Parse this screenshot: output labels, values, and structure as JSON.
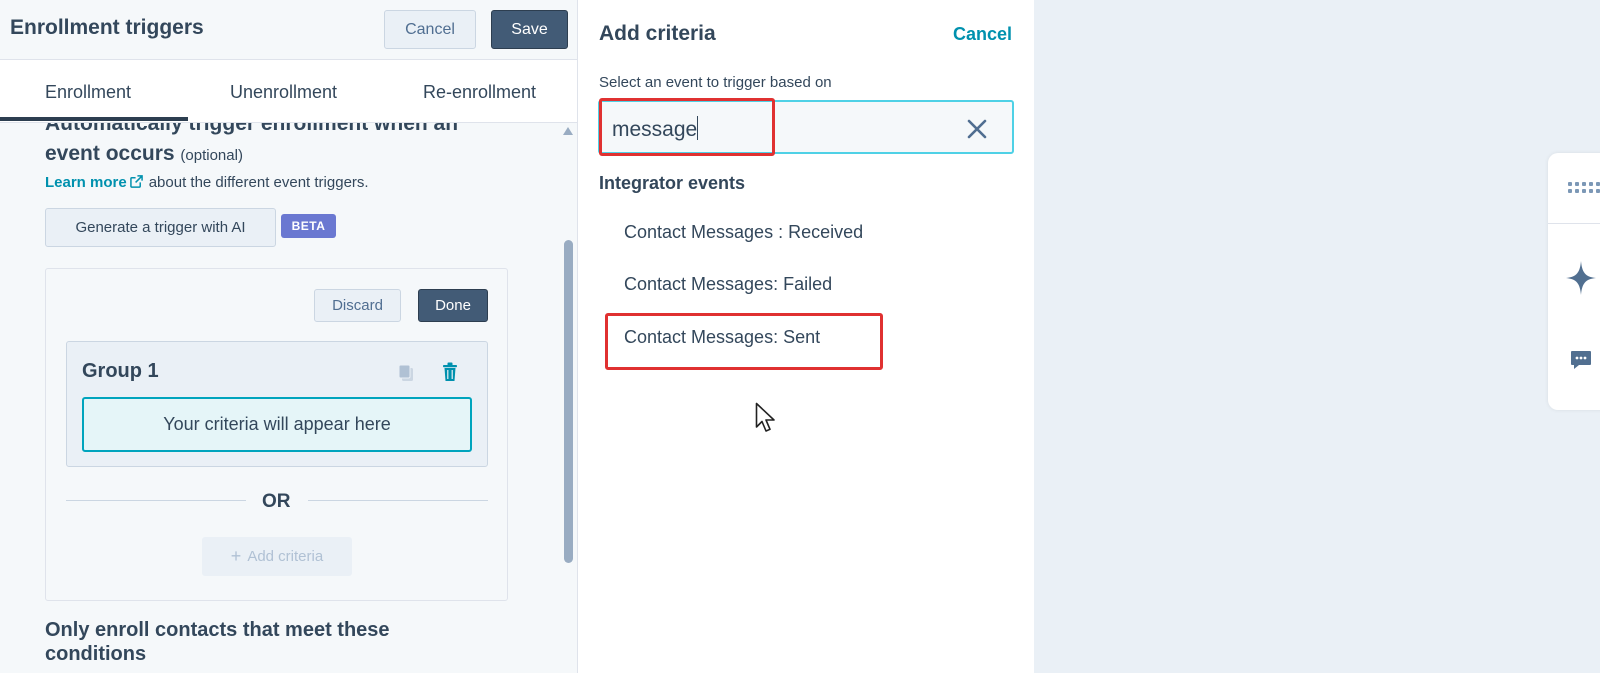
{
  "left_panel": {
    "title": "Enrollment triggers",
    "cancel_label": "Cancel",
    "save_label": "Save",
    "tabs": [
      {
        "label": "Enrollment",
        "active": true
      },
      {
        "label": "Unenrollment",
        "active": false
      },
      {
        "label": "Re-enrollment",
        "active": false
      }
    ],
    "section_heading": "Automatically trigger enrollment when an event occurs",
    "section_optional": "(optional)",
    "learn_more": "Learn more",
    "learn_more_suffix": "about the different event triggers.",
    "ai_button": "Generate a trigger with AI",
    "beta_badge": "BETA",
    "discard_label": "Discard",
    "done_label": "Done",
    "group_title": "Group 1",
    "criteria_placeholder": "Your criteria will appear here",
    "or_label": "OR",
    "add_criteria_label": "Add criteria",
    "only_enroll_heading": "Only enroll contacts that meet these conditions"
  },
  "drawer": {
    "title": "Add criteria",
    "cancel_label": "Cancel",
    "subtitle": "Select an event to trigger based on",
    "search_value": "message",
    "group_label": "Integrator events",
    "events": [
      "Contact Messages : Received",
      "Contact Messages: Failed",
      "Contact Messages: Sent"
    ]
  },
  "colors": {
    "accent": "#0091ae",
    "primary_dark": "#425b76",
    "highlight": "#e03131",
    "beta": "#6a78d1",
    "search_border": "#4fd1e6"
  },
  "icons": {
    "external_link": "external-link-icon",
    "copy": "copy-icon",
    "trash": "trash-icon",
    "clear": "close-icon",
    "grid": "grid-icon",
    "sparkle": "sparkle-icon",
    "chat": "chat-icon"
  }
}
